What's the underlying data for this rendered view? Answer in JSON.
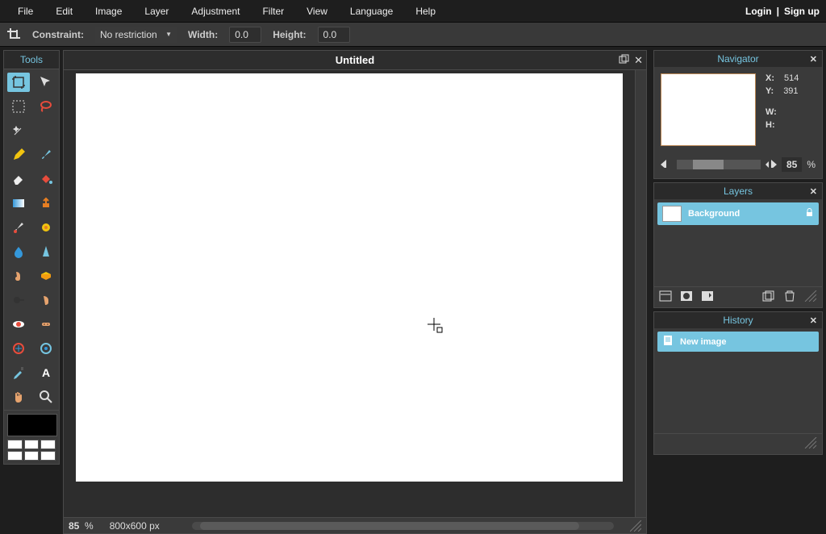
{
  "menubar": {
    "items": [
      "File",
      "Edit",
      "Image",
      "Layer",
      "Adjustment",
      "Filter",
      "View",
      "Language",
      "Help"
    ],
    "login": "Login",
    "signup": "Sign up"
  },
  "optionbar": {
    "constraint_label": "Constraint:",
    "constraint_value": "No restriction",
    "width_label": "Width:",
    "width_value": "0.0",
    "height_label": "Height:",
    "height_value": "0.0"
  },
  "tools": {
    "title": "Tools",
    "items": [
      "crop",
      "move",
      "marquee",
      "lasso",
      "wand",
      "",
      "pencil",
      "brush",
      "eraser",
      "paint-bucket",
      "gradient",
      "clone",
      "color-replace",
      "draw",
      "blur",
      "sharpen",
      "smudge",
      "sponge",
      "dodge",
      "burn",
      "red-eye",
      "spot-heal",
      "bloat",
      "pinch",
      "colorpicker",
      "type",
      "hand",
      "zoom"
    ]
  },
  "canvas": {
    "title": "Untitled",
    "zoom": "85",
    "pct": "%",
    "dimensions": "800x600 px"
  },
  "navigator": {
    "title": "Navigator",
    "x_label": "X:",
    "x": "514",
    "y_label": "Y:",
    "y": "391",
    "w_label": "W:",
    "w": "",
    "h_label": "H:",
    "h": "",
    "zoom": "85",
    "pct": "%"
  },
  "layers": {
    "title": "Layers",
    "items": [
      {
        "name": "Background",
        "locked": true
      }
    ]
  },
  "history": {
    "title": "History",
    "items": [
      {
        "name": "New image"
      }
    ]
  }
}
